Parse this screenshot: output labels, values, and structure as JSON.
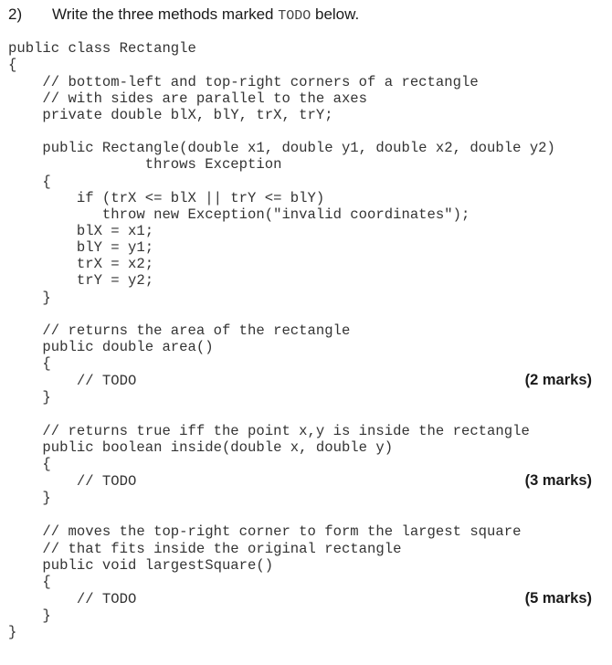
{
  "question": {
    "number": "2)",
    "text_before": "Write the three methods marked ",
    "code_word": "TODO",
    "text_after": " below."
  },
  "code_lines": [
    "public class Rectangle",
    "{",
    "    // bottom-left and top-right corners of a rectangle",
    "    // with sides are parallel to the axes",
    "    private double blX, blY, trX, trY;",
    "",
    "    public Rectangle(double x1, double y1, double x2, double y2)",
    "                throws Exception",
    "    {",
    "        if (trX <= blX || trY <= blY)",
    "           throw new Exception(\"invalid coordinates\");",
    "        blX = x1;",
    "        blY = y1;",
    "        trX = x2;",
    "        trY = y2;",
    "    }",
    "",
    "    // returns the area of the rectangle",
    "    public double area()",
    "    {",
    "        // TODO",
    "    }",
    "",
    "    // returns true iff the point x,y is inside the rectangle",
    "    public boolean inside(double x, double y)",
    "    {",
    "        // TODO",
    "    }",
    "",
    "    // moves the top-right corner to form the largest square",
    "    // that fits inside the original rectangle",
    "    public void largestSquare()",
    "    {",
    "        // TODO",
    "    }",
    "}"
  ],
  "marks": [
    {
      "method": "area",
      "label": "(2 marks)"
    },
    {
      "method": "inside",
      "label": "(3 marks)"
    },
    {
      "method": "largestSquare",
      "label": "(5 marks)"
    }
  ]
}
